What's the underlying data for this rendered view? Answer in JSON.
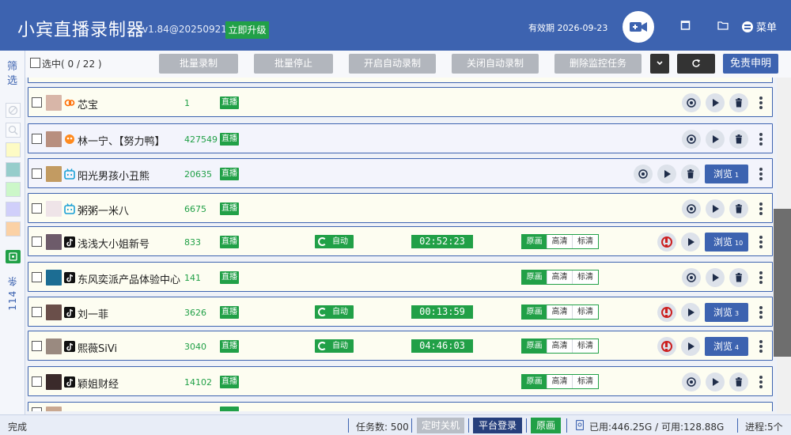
{
  "header": {
    "app_title": "小宾直播录制器",
    "version": "v1.84@20250921",
    "upgrade_label": "立即升级",
    "expiry_label": "有效期 2026-09-23",
    "menu_label": "菜单"
  },
  "filter": {
    "label": "筛选",
    "count_label": "114 条"
  },
  "toolbar": {
    "select_label": "选中( 0  /  22 )",
    "batch_record": "批量录制",
    "batch_stop": "批量停止",
    "enable_auto": "开启自动录制",
    "disable_auto": "关闭自动录制",
    "delete_monitor": "删除监控任务",
    "disclaimer": "免责申明"
  },
  "rows": [
    {
      "name": "芯宝",
      "count": "1",
      "status": "直播",
      "platform": "kuaishou",
      "bg": "#fdfdf1"
    },
    {
      "name": "林一宁、【努力鸭】",
      "count": "427549",
      "status": "直播",
      "platform": "kuaishou",
      "bg": "#f3f4fc"
    },
    {
      "name": "阳光男孩小丑熊",
      "count": "20635",
      "status": "直播",
      "platform": "bilibili",
      "bg": "#f3f4fc",
      "preview": "浏览",
      "preview_num": "1"
    },
    {
      "name": "粥粥一米八",
      "count": "6675",
      "status": "直播",
      "platform": "bilibili",
      "bg": "#fdfdf1"
    },
    {
      "name": "浅浅大小姐新号",
      "count": "833",
      "status": "直播",
      "platform": "douyin",
      "bg": "#fdfdf1",
      "auto": "自动",
      "timer": "02:52:23",
      "q1": "原画",
      "q2": "高清",
      "q3": "标清",
      "preview": "浏览",
      "preview_num": "10"
    },
    {
      "name": "东风奕派产品体验中心",
      "count": "141",
      "status": "直播",
      "platform": "douyin",
      "bg": "#fdfdf1",
      "q1": "原画",
      "q2": "高清",
      "q3": "标清"
    },
    {
      "name": "刘一菲",
      "count": "3626",
      "status": "直播",
      "platform": "douyin",
      "bg": "#fdfdf1",
      "auto": "自动",
      "timer": "00:13:59",
      "q1": "原画",
      "q2": "高清",
      "q3": "标清",
      "preview": "浏览",
      "preview_num": "3"
    },
    {
      "name": "熙薇SiVi",
      "count": "3040",
      "status": "直播",
      "platform": "douyin",
      "bg": "#fdfdf1",
      "auto": "自动",
      "timer": "04:46:03",
      "q1": "原画",
      "q2": "高清",
      "q3": "标清",
      "preview": "浏览",
      "preview_num": "4"
    },
    {
      "name": "颖姐财经",
      "count": "14102",
      "status": "直播",
      "platform": "douyin",
      "bg": "#fdfdf1",
      "q1": "原画",
      "q2": "高清",
      "q3": "标清"
    }
  ],
  "statusbar": {
    "done": "完成",
    "tasks": "任务数: 500",
    "shutdown": "定时关机",
    "platform_login": "平台登录",
    "original": "原画",
    "disk": "已用:446.25G / 可用:128.88G",
    "progress": "进程:5个"
  },
  "colors": {
    "primary": "#3d63b0",
    "live_green": "#21a047",
    "record_red": "#cc1f1f"
  }
}
